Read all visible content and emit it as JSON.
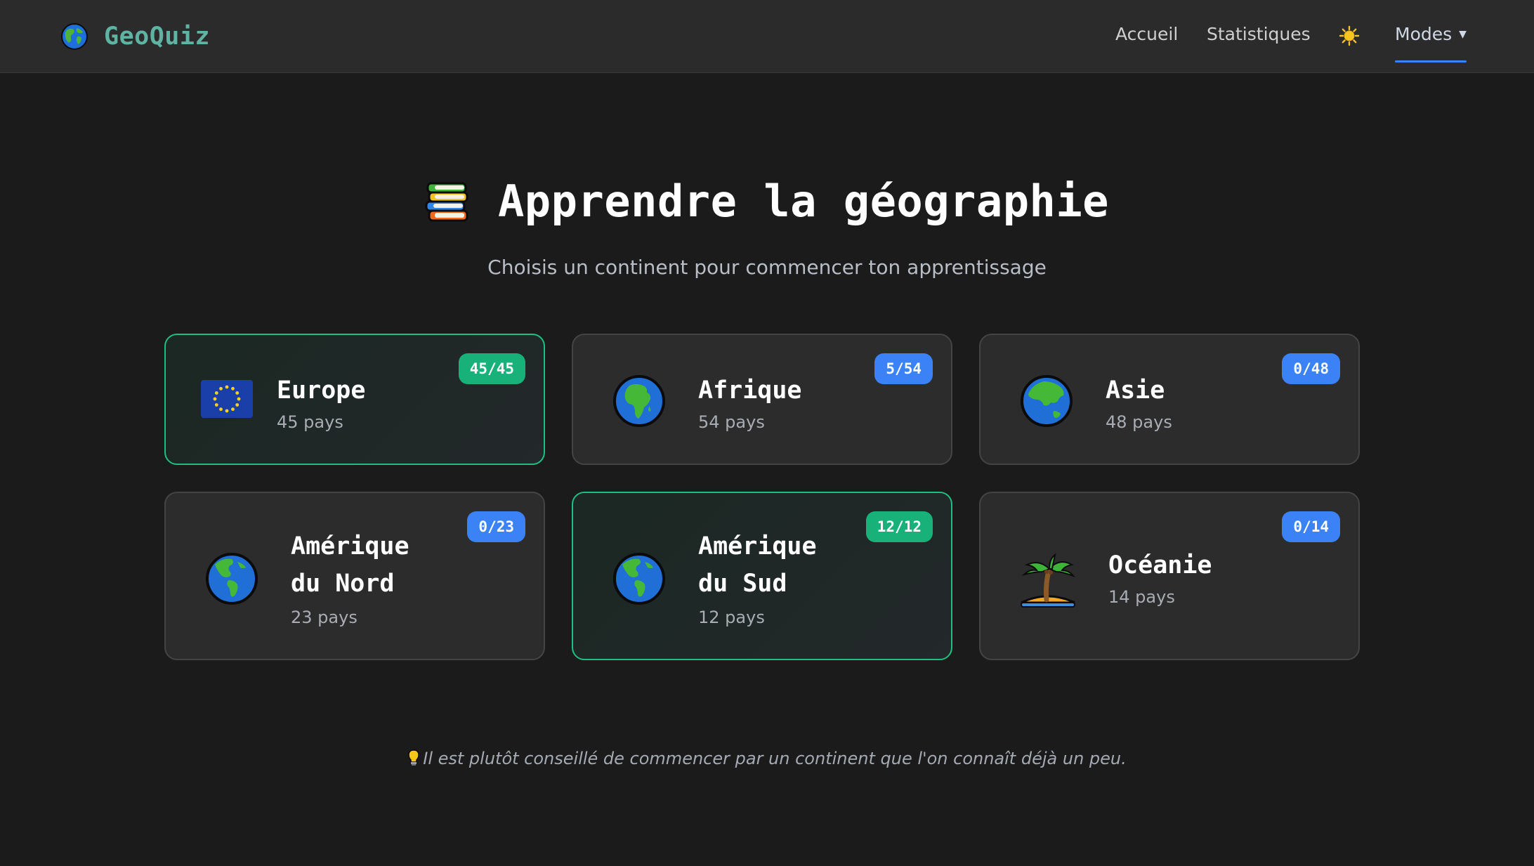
{
  "nav": {
    "brand": "GeoQuiz",
    "links": [
      "Accueil",
      "Statistiques"
    ],
    "modes_label": "Modes"
  },
  "hero": {
    "title": "Apprendre la géographie",
    "subtitle": "Choisis un continent pour commencer ton apprentissage"
  },
  "continents": [
    {
      "name": "Europe",
      "count": "45 pays",
      "badge": "45/45",
      "icon": "eu-flag-icon",
      "completed": true
    },
    {
      "name": "Afrique",
      "count": "54 pays",
      "badge": "5/54",
      "icon": "globe-africa-icon",
      "completed": false
    },
    {
      "name": "Asie",
      "count": "48 pays",
      "badge": "0/48",
      "icon": "globe-asia-icon",
      "completed": false
    },
    {
      "name_line1": "Amérique",
      "name_line2": "du Nord",
      "count": "23 pays",
      "badge": "0/23",
      "icon": "globe-americas-icon",
      "completed": false
    },
    {
      "name_line1": "Amérique",
      "name_line2": "du Sud",
      "count": "12 pays",
      "badge": "12/12",
      "icon": "globe-americas-icon",
      "completed": true
    },
    {
      "name": "Océanie",
      "count": "14 pays",
      "badge": "0/14",
      "icon": "palm-island-icon",
      "completed": false
    }
  ],
  "tip": "Il est plutôt conseillé de commencer par un continent que l'on connaît déjà un peu.",
  "colors": {
    "background": "#1b1b1b",
    "navbar": "#2b2b2b",
    "card": "#2c2c2c",
    "accent_blue": "#3b82f6",
    "accent_green": "#18b17a",
    "brand": "#5fb3a3"
  }
}
